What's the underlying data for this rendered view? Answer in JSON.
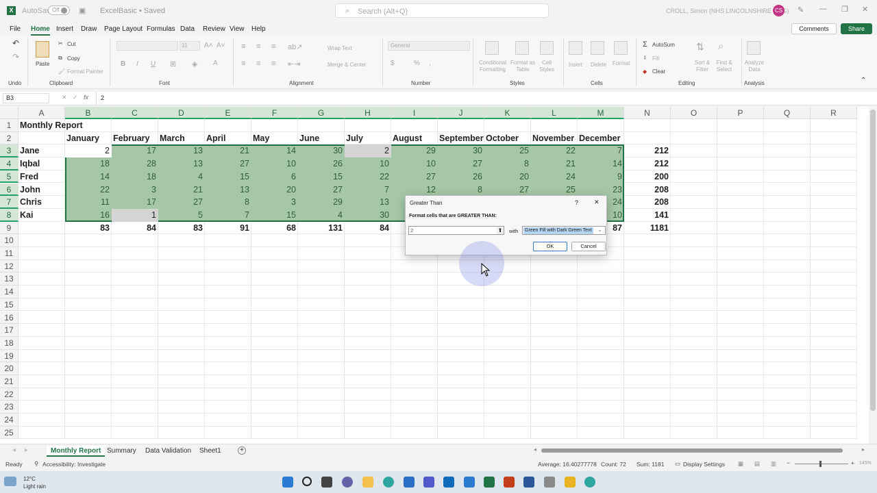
{
  "titlebar": {
    "autosave": "AutoSave",
    "toggle": "Off",
    "filename": "ExcelBasic • Saved",
    "search_placeholder": "Search (Alt+Q)",
    "user": "CROLL, Simon (NHS LINCOLNSHIRE CCG)",
    "initials": "CS"
  },
  "menu": {
    "items": [
      "File",
      "Home",
      "Insert",
      "Draw",
      "Page Layout",
      "Formulas",
      "Data",
      "Review",
      "View",
      "Help"
    ],
    "active": "Home",
    "comments": "Comments",
    "share": "Share"
  },
  "ribbon": {
    "undo_group": "Undo",
    "clipboard_group": "Clipboard",
    "paste": "Paste",
    "cut": "Cut",
    "copy": "Copy",
    "format_painter": "Format Painter",
    "font_group": "Font",
    "font_size": "11",
    "alignment_group": "Alignment",
    "wrap_text": "Wrap Text",
    "merge_center": "Merge & Center",
    "number_group": "Number",
    "number_format": "General",
    "styles_group": "Styles",
    "conditional_formatting": "Conditional Formatting",
    "format_as_table": "Format as Table",
    "cell_styles": "Cell Styles",
    "cells_group": "Cells",
    "insert": "Insert",
    "delete": "Delete",
    "format": "Format",
    "editing_group": "Editing",
    "autosum": "AutoSum",
    "fill": "Fill",
    "clear": "Clear",
    "sort_filter": "Sort & Filter",
    "find_select": "Find & Select",
    "analysis_group": "Analysis",
    "analyze_data": "Analyze Data"
  },
  "formula_bar": {
    "name_box": "B3",
    "fx": "fx",
    "value": "2"
  },
  "columns": [
    "A",
    "B",
    "C",
    "D",
    "E",
    "F",
    "G",
    "H",
    "I",
    "J",
    "K",
    "L",
    "M",
    "N",
    "O",
    "P",
    "Q",
    "R"
  ],
  "rows": [
    "1",
    "2",
    "3",
    "4",
    "5",
    "6",
    "7",
    "8",
    "9",
    "10",
    "11",
    "12",
    "13",
    "14",
    "15",
    "16",
    "17",
    "18",
    "19",
    "20",
    "21",
    "22",
    "23",
    "24",
    "25"
  ],
  "sheet": {
    "title": "Monthly Report",
    "months": [
      "January",
      "February",
      "March",
      "April",
      "May",
      "June",
      "July",
      "August",
      "September",
      "October",
      "November",
      "December"
    ],
    "people": [
      {
        "name": "Jane",
        "values": [
          "2",
          "17",
          "13",
          "21",
          "14",
          "30",
          "2",
          "29",
          "30",
          "25",
          "22",
          "7"
        ],
        "total": "212"
      },
      {
        "name": "Iqbal",
        "values": [
          "18",
          "28",
          "13",
          "27",
          "10",
          "26",
          "10",
          "10",
          "27",
          "8",
          "21",
          "14"
        ],
        "total": "212"
      },
      {
        "name": "Fred",
        "values": [
          "14",
          "18",
          "4",
          "15",
          "6",
          "15",
          "22",
          "27",
          "26",
          "20",
          "24",
          "9"
        ],
        "total": "200"
      },
      {
        "name": "John",
        "values": [
          "22",
          "3",
          "21",
          "13",
          "20",
          "27",
          "7",
          "12",
          "8",
          "27",
          "25",
          "23"
        ],
        "total": "208"
      },
      {
        "name": "Chris",
        "values": [
          "11",
          "17",
          "27",
          "8",
          "3",
          "29",
          "13",
          "",
          "",
          "",
          "",
          "24"
        ],
        "total": "208"
      },
      {
        "name": "Kai",
        "values": [
          "16",
          "1",
          "5",
          "7",
          "15",
          "4",
          "30",
          "",
          "",
          "",
          "",
          "10"
        ],
        "total": "141"
      }
    ],
    "totals": [
      "83",
      "84",
      "83",
      "91",
      "68",
      "131",
      "84",
      "",
      "",
      "",
      "",
      "87"
    ],
    "grand_total": "1181"
  },
  "dialog": {
    "title": "Greater Than",
    "help": "?",
    "close": "✕",
    "prompt": "Format cells that are GREATER THAN:",
    "value": "2",
    "with": "with",
    "format": "Green Fill with Dark Green Text",
    "ok": "OK",
    "cancel": "Cancel"
  },
  "sheet_tabs": [
    "Monthly Report",
    "Summary",
    "Data Validation",
    "Sheet1"
  ],
  "status": {
    "ready": "Ready",
    "accessibility": "Accessibility: Investigate",
    "average": "Average: 16.40277778",
    "count": "Count: 72",
    "sum": "Sum: 1181",
    "display": "Display Settings",
    "zoom": "145%"
  },
  "taskbar": {
    "temp": "12°C",
    "weather": "Light rain"
  },
  "colors": {
    "excel_green": "#217346",
    "selection_fill": "#a5c7a7",
    "gray_fill": "#d4d4d4"
  }
}
